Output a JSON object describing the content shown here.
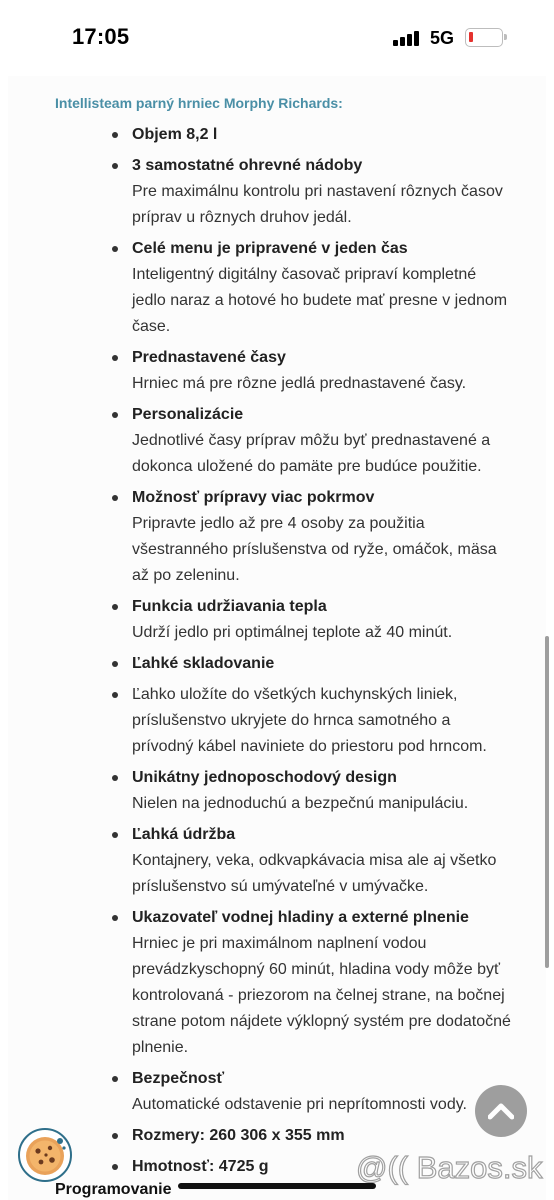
{
  "status_bar": {
    "time": "17:05",
    "network": "5G",
    "battery_color": "#e5322f"
  },
  "product_title": "Intellisteam parný hrniec Morphy Richards:",
  "features": [
    {
      "title": "Objem 8,2 l",
      "desc": ""
    },
    {
      "title": "3 samostatné ohrevné nádoby",
      "desc": "Pre maximálnu kontrolu pri nastavení rôznych časov príprav u rôznych druhov jedál."
    },
    {
      "title": "Celé menu je pripravené v jeden čas",
      "desc": "Inteligentný digitálny časovač pripraví kompletné jedlo naraz a hotové ho budete mať presne v jednom čase."
    },
    {
      "title": "Prednastavené časy",
      "desc": "Hrniec má pre rôzne jedlá prednastavené časy."
    },
    {
      "title": "Personalizácie",
      "desc": "Jednotlivé časy príprav môžu byť prednastavené a dokonca uložené do pamäte pre budúce použitie."
    },
    {
      "title": "Možnosť prípravy viac pokrmov",
      "desc": "Pripravte jedlo až pre 4 osoby za použitia všestranného príslušenstva od ryže, omáčok, mäsa až po zeleninu."
    },
    {
      "title": "Funkcia udržiavania tepla",
      "desc": "Udrží jedlo pri optimálnej teplote až 40 minút."
    },
    {
      "title": "Ľahké skladovanie",
      "desc": ""
    },
    {
      "title": "",
      "desc": "Ľahko uložíte do všetkých kuchynských liniek, príslušenstvo ukryjete do hrnca samotného a prívodný kábel naviniete do priestoru pod hrncom."
    },
    {
      "title": "Unikátny jednoposchodový design",
      "desc": "Nielen na jednoduchú a bezpečnú manipuláciu."
    },
    {
      "title": "Ľahká údržba",
      "desc": "Kontajnery, veka, odkvapkávacia misa ale aj všetko príslušenstvo sú umývateľné v umývačke."
    },
    {
      "title": "Ukazovateľ vodnej hladiny a externé plnenie",
      "desc": "Hrniec je pri maximálnom naplnení vodou prevádzkyschopný 60 minút, hladina vody môže byť kontrolovaná - priezorom na čelnej strane, na bočnej strane potom nájdete výklopný systém pre dodatočné plnenie."
    },
    {
      "title": "Bezpečnosť",
      "desc": "Automatické odstavenie pri neprítomnosti vody."
    },
    {
      "title": "Rozmery: 260 306 x 355 mm",
      "desc": ""
    },
    {
      "title": "Hmotnosť: 4725 g",
      "desc": ""
    }
  ],
  "cookie_label": "Programovanie",
  "watermark": "@(( Bazos.sk",
  "colors": {
    "title_accent": "#4a8fa6",
    "cookie_border": "#2f6f8a",
    "scroll_button": "#9a9a9a"
  }
}
